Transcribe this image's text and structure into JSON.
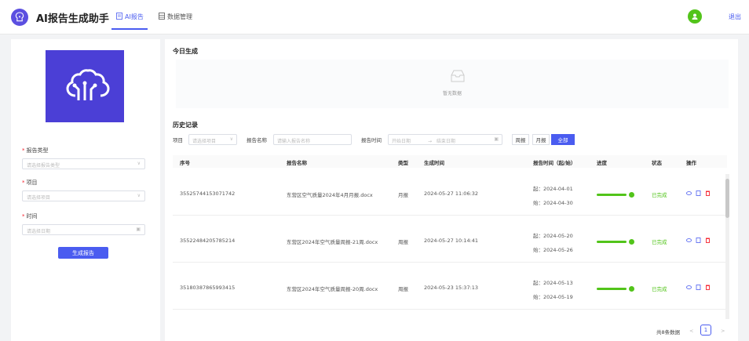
{
  "app": {
    "title": "AI报告生成助手"
  },
  "nav": {
    "tabs": [
      {
        "label": "AI报告"
      },
      {
        "label": "数据管理"
      }
    ]
  },
  "header": {
    "logout": "退出"
  },
  "form": {
    "report_type": {
      "label": "报告类型",
      "placeholder": "请选择报告类型"
    },
    "project": {
      "label": "项目",
      "placeholder": "请选择项目"
    },
    "time": {
      "label": "时间",
      "placeholder": "请选择日期"
    },
    "generate_button": "生成报告"
  },
  "today": {
    "title": "今日生成",
    "empty_text": "暂无数据"
  },
  "history": {
    "title": "历史记录",
    "filters": {
      "project_label": "项目",
      "project_placeholder": "请选择项目",
      "name_label": "报告名称",
      "name_placeholder": "请输入报告名称",
      "time_label": "报告时间",
      "start_placeholder": "开始日期",
      "separator": "→",
      "end_placeholder": "结束日期",
      "segments": [
        "周报",
        "月报",
        "全部"
      ],
      "active_segment": "全部"
    },
    "columns": [
      "序号",
      "报告名称",
      "类型",
      "生成时间",
      "报告时间（起/始）",
      "进度",
      "状态",
      "操作"
    ],
    "rows": [
      {
        "id": "35525744153071742",
        "name": "东营区空气质量2024年4月月报.docx",
        "type": "月报",
        "created": "2024-05-27 11:06:32",
        "start": "起：2024-04-01",
        "end": "始：2024-04-30",
        "progress": 100,
        "status": "已完成"
      },
      {
        "id": "35522484205785214",
        "name": "东营区2024年空气质量周报-21周.docx",
        "type": "周报",
        "created": "2024-05-27 10:14:41",
        "start": "起：2024-05-20",
        "end": "始：2024-05-26",
        "progress": 100,
        "status": "已完成"
      },
      {
        "id": "35180387865993415",
        "name": "东营区2024年空气质量周报-20周.docx",
        "type": "周报",
        "created": "2024-05-23 15:37:13",
        "start": "起：2024-05-13",
        "end": "始：2024-05-19",
        "progress": 100,
        "status": "已完成"
      }
    ],
    "pagination": {
      "total_text": "共8条数据",
      "current_page": "1",
      "prev": "<",
      "next": ">"
    }
  },
  "colors": {
    "accent": "#4a5cf0",
    "success": "#52c41a",
    "danger": "#f5222d",
    "brand": "#4b3fd6"
  }
}
